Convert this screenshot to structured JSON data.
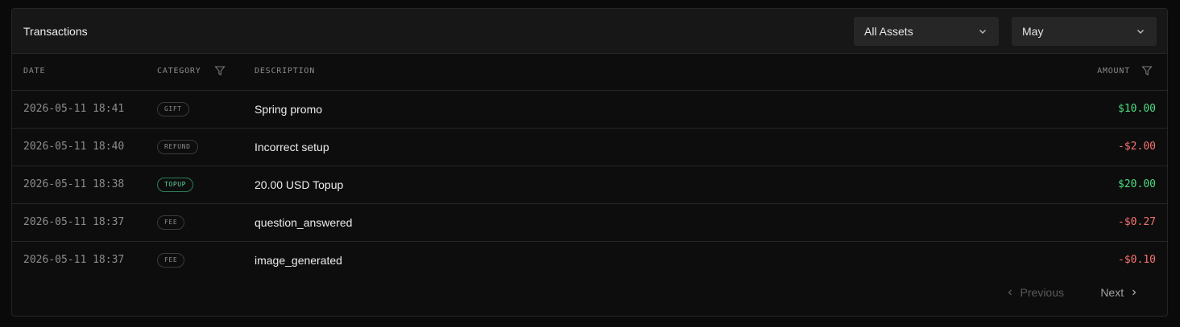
{
  "header": {
    "title": "Transactions",
    "asset_filter": {
      "value": "All Assets",
      "icon": "chevron-down-icon"
    },
    "month_filter": {
      "value": "May",
      "icon": "chevron-down-icon"
    }
  },
  "table": {
    "columns": {
      "date": "DATE",
      "category": "CATEGORY",
      "description": "DESCRIPTION",
      "amount": "AMOUNT"
    },
    "rows": [
      {
        "date": "2026-05-11 18:41",
        "category": "GIFT",
        "description": "Spring promo",
        "amount": "$10.00",
        "sign": "positive"
      },
      {
        "date": "2026-05-11 18:40",
        "category": "REFUND",
        "description": "Incorrect setup",
        "amount": "-$2.00",
        "sign": "negative"
      },
      {
        "date": "2026-05-11 18:38",
        "category": "TOPUP",
        "description": "20.00 USD Topup",
        "amount": "$20.00",
        "sign": "positive"
      },
      {
        "date": "2026-05-11 18:37",
        "category": "FEE",
        "description": "question_answered",
        "amount": "-$0.27",
        "sign": "negative"
      },
      {
        "date": "2026-05-11 18:37",
        "category": "FEE",
        "description": "image_generated",
        "amount": "-$0.10",
        "sign": "negative"
      }
    ]
  },
  "pagination": {
    "previous_label": "Previous",
    "next_label": "Next"
  },
  "colors": {
    "positive": "#4ade80",
    "negative": "#f87171",
    "topup_badge": "#5fd39a"
  }
}
